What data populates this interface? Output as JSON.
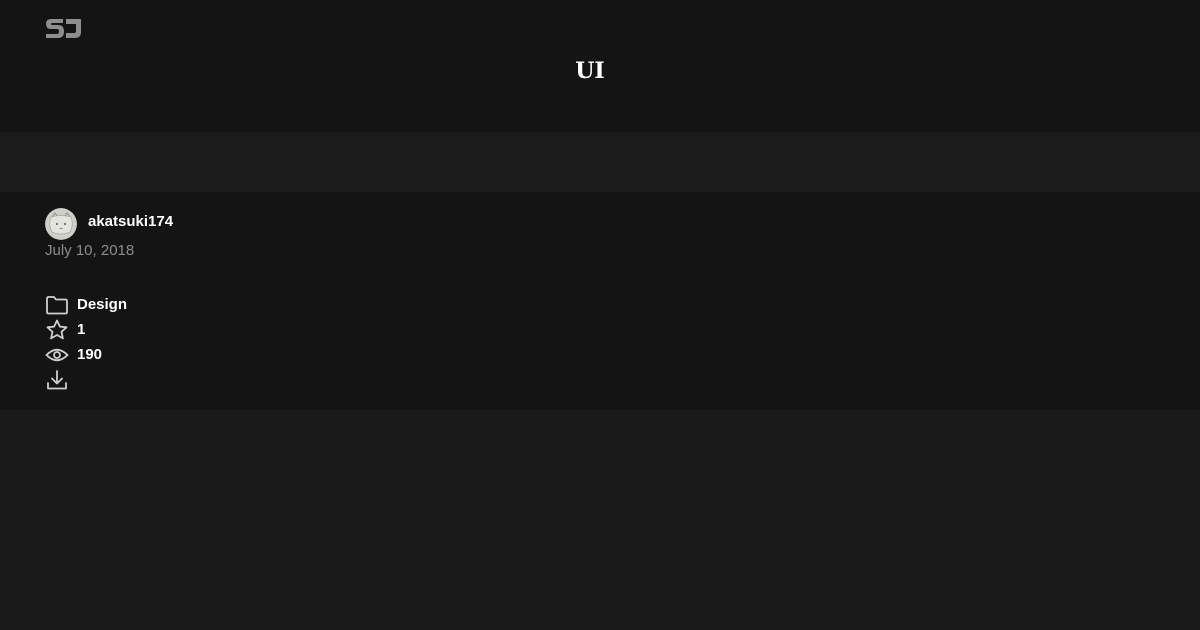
{
  "header": {
    "logo": "sj-logo",
    "title": "UI"
  },
  "author": {
    "username": "akatsuki174",
    "avatar": "cat-avatar",
    "date": "July 10, 2018"
  },
  "meta": {
    "category": "Design",
    "stars": "1",
    "views": "190",
    "icons": [
      "folder-icon",
      "star-icon",
      "eye-icon",
      "download-icon"
    ]
  },
  "colors": {
    "header_bg": "#141414",
    "page_bg": "#1a1a1a",
    "text": "#ffffff",
    "muted": "#8c8c8c",
    "icon": "#cfcfcf"
  }
}
